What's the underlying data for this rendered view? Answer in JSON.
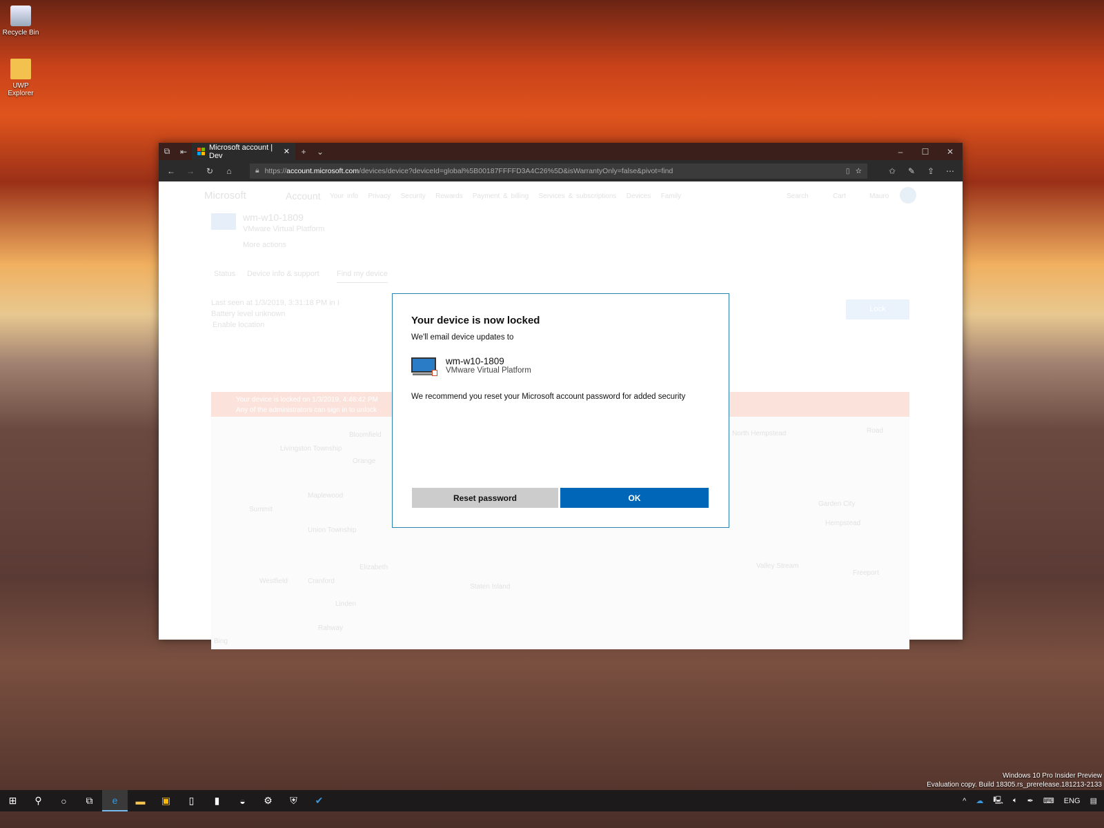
{
  "desktop": {
    "icons": [
      {
        "label": "Recycle Bin",
        "icon": "recycle-bin-icon"
      },
      {
        "label": "UWP Explorer",
        "icon": "folder-icon"
      }
    ]
  },
  "browser": {
    "tab_title": "Microsoft account | Dev",
    "url_prefix": "https://",
    "url_domain": "account.microsoft.com",
    "url_path": "/devices/device?deviceId=global%5B00187FFFFD3A4C26%5D&isWarrantyOnly=false&pivot=find"
  },
  "page": {
    "brand": "Microsoft",
    "section": "Account",
    "nav": [
      "Your info",
      "Privacy",
      "Security",
      "Rewards",
      "Payment & billing",
      "Services & subscriptions",
      "Devices",
      "Family"
    ],
    "search": "Search",
    "cart": "Cart",
    "user": "Mauro",
    "device_name": "wm-w10-1809",
    "device_platform": "VMware Virtual Platform",
    "more_actions": "More actions",
    "tabs": [
      "Status",
      "Device info & support",
      "Find my device"
    ],
    "last_seen": "Last seen at 1/3/2019, 3:31:18 PM in I",
    "battery": "Battery level unknown",
    "enable_location": "Enable location",
    "lock_button": "Lock",
    "banner_line1": "Your device is locked on 1/3/2019, 4:46:42 PM",
    "banner_line2": "Any of the administrators can sign in to unlock",
    "map_labels": [
      "Livingston Township",
      "Bloomfield",
      "Orange",
      "Maplewood",
      "Summit",
      "Union Township",
      "Elizabeth",
      "Westfield",
      "Cranford",
      "Linden",
      "Rahway",
      "Staten Island",
      "North Hempstead",
      "Garden City",
      "Hempstead",
      "Freeport",
      "Valley Stream",
      "Road"
    ],
    "map_attribution": "Bing"
  },
  "dialog": {
    "title": "Your device is now locked",
    "subtitle": "We'll email device updates to",
    "device_name": "wm-w10-1809",
    "device_platform": "VMware Virtual Platform",
    "recommendation": "We recommend you reset your Microsoft account password for added security",
    "reset_button": "Reset password",
    "ok_button": "OK"
  },
  "watermark": {
    "line1": "Windows 10 Pro Insider Preview",
    "line2": "Evaluation copy. Build 18305.rs_prerelease.181213-2133"
  },
  "taskbar": {
    "language": "ENG"
  }
}
